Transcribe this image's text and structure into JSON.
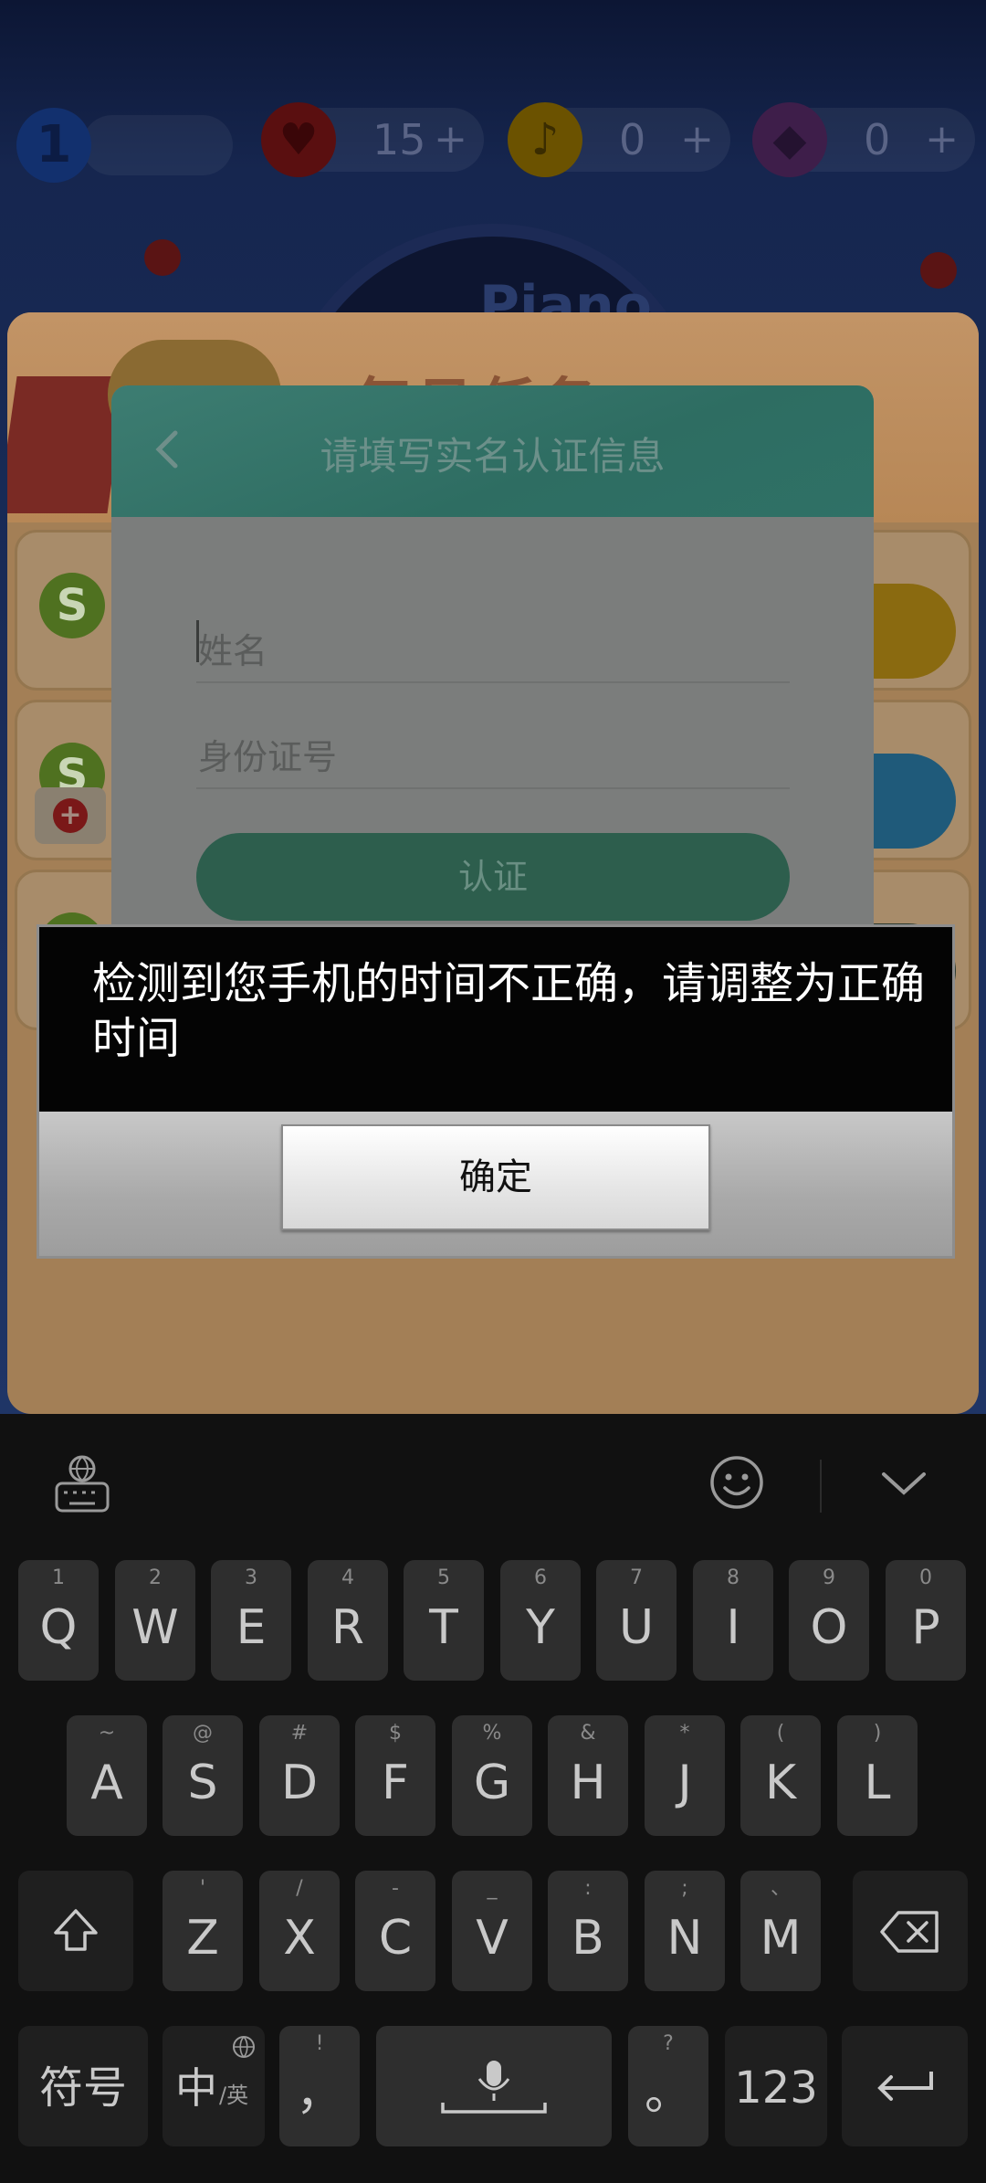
{
  "game": {
    "level": "1",
    "stats": [
      {
        "icon": "heart-icon",
        "value": "15",
        "plus": "+",
        "color": "#5a0f10"
      },
      {
        "icon": "music-note-icon",
        "value": "0",
        "plus": "+",
        "color": "#6b5200"
      },
      {
        "icon": "diamond-icon",
        "value": "0",
        "plus": "+",
        "color": "#3e1e4a"
      }
    ],
    "piano_text": "Piano"
  },
  "task_panel": {
    "title": "每日任务",
    "rows": [
      {
        "badge": "S",
        "button_color": "#8a6a10"
      },
      {
        "badge": "S",
        "button_color": "#1f5a7a"
      },
      {
        "badge": "S",
        "button_color": "#2a3a30"
      }
    ]
  },
  "realname_dialog": {
    "title": "请填写实名认证信息",
    "name_placeholder": "姓名",
    "id_placeholder": "身份证号",
    "submit_label": "认证"
  },
  "alert": {
    "message": "检测到您手机的时间不正确，请调整为正确时间",
    "ok_label": "确定"
  },
  "keyboard": {
    "row1": [
      {
        "main": "Q",
        "sub": "1"
      },
      {
        "main": "W",
        "sub": "2"
      },
      {
        "main": "E",
        "sub": "3"
      },
      {
        "main": "R",
        "sub": "4"
      },
      {
        "main": "T",
        "sub": "5"
      },
      {
        "main": "Y",
        "sub": "6"
      },
      {
        "main": "U",
        "sub": "7"
      },
      {
        "main": "I",
        "sub": "8"
      },
      {
        "main": "O",
        "sub": "9"
      },
      {
        "main": "P",
        "sub": "0"
      }
    ],
    "row2": [
      {
        "main": "A",
        "sub": "~"
      },
      {
        "main": "S",
        "sub": "@"
      },
      {
        "main": "D",
        "sub": "#"
      },
      {
        "main": "F",
        "sub": "$"
      },
      {
        "main": "G",
        "sub": "%"
      },
      {
        "main": "H",
        "sub": "&"
      },
      {
        "main": "J",
        "sub": "*"
      },
      {
        "main": "K",
        "sub": "("
      },
      {
        "main": "L",
        "sub": ")"
      }
    ],
    "row3": [
      {
        "main": "Z",
        "sub": "'"
      },
      {
        "main": "X",
        "sub": "/"
      },
      {
        "main": "C",
        "sub": "-"
      },
      {
        "main": "V",
        "sub": "_"
      },
      {
        "main": "B",
        "sub": ":"
      },
      {
        "main": "N",
        "sub": ";"
      },
      {
        "main": "M",
        "sub": "、"
      }
    ],
    "symbols_label": "符号",
    "lang_main": "中",
    "lang_sub": "/英",
    "comma_main": "，",
    "comma_sub": "!",
    "period_main": "。",
    "period_sub": "?",
    "num_label": "123"
  }
}
